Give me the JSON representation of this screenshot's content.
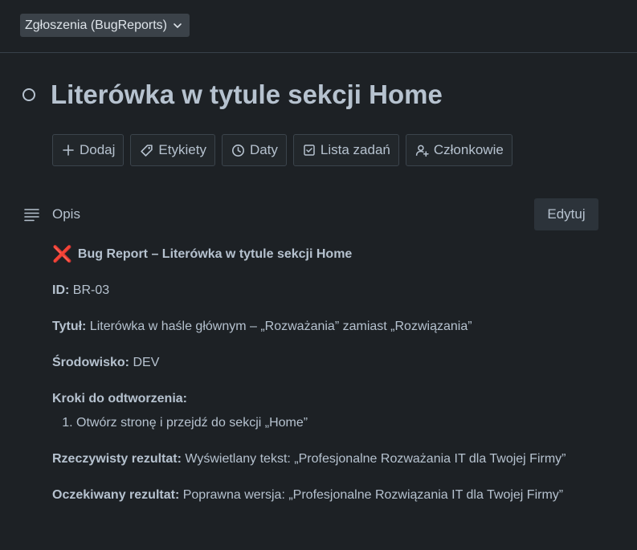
{
  "header": {
    "list_selector": "Zgłoszenia (BugReports)"
  },
  "card": {
    "title": "Literówka w tytule sekcji Home"
  },
  "actions": [
    {
      "label": "Dodaj",
      "icon": "plus-icon"
    },
    {
      "label": "Etykiety",
      "icon": "tag-icon"
    },
    {
      "label": "Daty",
      "icon": "clock-icon"
    },
    {
      "label": "Lista zadań",
      "icon": "checklist-icon"
    },
    {
      "label": "Członkowie",
      "icon": "add-member-icon"
    }
  ],
  "description": {
    "label": "Opis",
    "edit_label": "Edytuj",
    "heading_icon": "❌",
    "heading": "Bug Report – Literówka w tytule sekcji Home",
    "id_label": "ID:",
    "id_value": " BR-03",
    "title_label": "Tytuł:",
    "title_value": " Literówka w haśle głównym – „Rozważania” zamiast „Rozwiązania”",
    "env_label": "Środowisko:",
    "env_value": " DEV",
    "steps_label": "Kroki do odtworzenia:",
    "steps": [
      "Otwórz stronę i przejdź do sekcji „Home”"
    ],
    "actual_label": "Rzeczywisty rezultat:",
    "actual_value": " Wyświetlany tekst: „Profesjonalne Rozważania IT dla Twojej Firmy”",
    "expected_label": "Oczekiwany rezultat:",
    "expected_value": " Poprawna wersja: „Profesjonalne Rozwiązania IT dla Twojej Firmy”"
  },
  "colors": {
    "background": "#1d2125",
    "text": "#b6c2cf",
    "button_bg": "#2c333a",
    "error_icon": "#f15c75"
  }
}
